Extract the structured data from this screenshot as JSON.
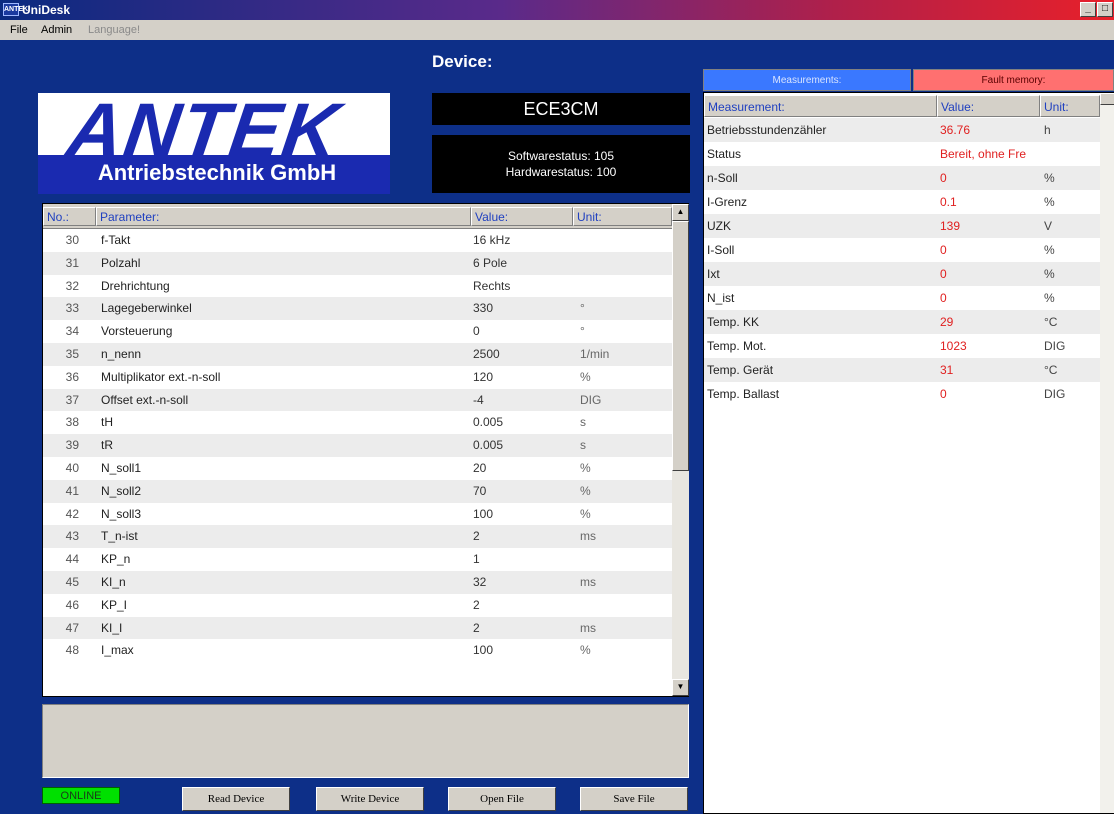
{
  "window": {
    "title": "UniDesk",
    "icon_text": "ANTEK",
    "controls": [
      "_",
      "□",
      "x"
    ]
  },
  "menu": [
    {
      "label": "File",
      "enabled": true
    },
    {
      "label": "Admin",
      "enabled": true
    },
    {
      "label": "Language!",
      "enabled": false
    }
  ],
  "logo": {
    "word": "ANTEK",
    "subtitle": "Antriebstechnik GmbH"
  },
  "device": {
    "label": "Device:",
    "name": "ECE3CM",
    "software_status": "Softwarestatus: 105",
    "hardware_status": "Hardwarestatus: 100"
  },
  "parameters": {
    "headers": {
      "no": "No.:",
      "parameter": "Parameter:",
      "value": "Value:",
      "unit": "Unit:"
    },
    "rows": [
      {
        "no": "30",
        "name": "f-Takt",
        "value": "16 kHz",
        "unit": ""
      },
      {
        "no": "31",
        "name": "Polzahl",
        "value": "6 Pole",
        "unit": ""
      },
      {
        "no": "32",
        "name": "Drehrichtung",
        "value": "Rechts",
        "unit": ""
      },
      {
        "no": "33",
        "name": "Lagegeberwinkel",
        "value": "330",
        "unit": "°"
      },
      {
        "no": "34",
        "name": "Vorsteuerung",
        "value": "0",
        "unit": "°"
      },
      {
        "no": "35",
        "name": "n_nenn",
        "value": "2500",
        "unit": "1/min"
      },
      {
        "no": "36",
        "name": "Multiplikator ext.-n-soll",
        "value": "120",
        "unit": "%"
      },
      {
        "no": "37",
        "name": "Offset ext.-n-soll",
        "value": "-4",
        "unit": "DIG"
      },
      {
        "no": "38",
        "name": "tH",
        "value": "0.005",
        "unit": "s"
      },
      {
        "no": "39",
        "name": "tR",
        "value": "0.005",
        "unit": "s"
      },
      {
        "no": "40",
        "name": "N_soll1",
        "value": "20",
        "unit": "%"
      },
      {
        "no": "41",
        "name": "N_soll2",
        "value": "70",
        "unit": "%"
      },
      {
        "no": "42",
        "name": "N_soll3",
        "value": "100",
        "unit": "%"
      },
      {
        "no": "43",
        "name": "T_n-ist",
        "value": "2",
        "unit": "ms"
      },
      {
        "no": "44",
        "name": "KP_n",
        "value": "1",
        "unit": ""
      },
      {
        "no": "45",
        "name": "KI_n",
        "value": "32",
        "unit": "ms"
      },
      {
        "no": "46",
        "name": "KP_I",
        "value": "2",
        "unit": ""
      },
      {
        "no": "47",
        "name": "KI_I",
        "value": "2",
        "unit": "ms"
      },
      {
        "no": "48",
        "name": "I_max",
        "value": "100",
        "unit": "%"
      }
    ]
  },
  "measurements": {
    "tabs": {
      "measurements": "Measurements:",
      "fault_memory": "Fault memory:"
    },
    "headers": {
      "measurement": "Measurement:",
      "value": "Value:",
      "unit": "Unit:"
    },
    "rows": [
      {
        "name": "Betriebsstundenzähler",
        "value": "36.76",
        "unit": "h"
      },
      {
        "name": "Status",
        "value": "Bereit, ohne Fre",
        "unit": ""
      },
      {
        "name": "n-Soll",
        "value": "0",
        "unit": "%"
      },
      {
        "name": "I-Grenz",
        "value": "0.1",
        "unit": "%"
      },
      {
        "name": "UZK",
        "value": "139",
        "unit": "V"
      },
      {
        "name": "I-Soll",
        "value": "0",
        "unit": "%"
      },
      {
        "name": "Ixt",
        "value": "0",
        "unit": "%"
      },
      {
        "name": "N_ist",
        "value": "0",
        "unit": "%"
      },
      {
        "name": "Temp. KK",
        "value": "29",
        "unit": "°C"
      },
      {
        "name": "Temp. Mot.",
        "value": "1023",
        "unit": "DIG"
      },
      {
        "name": "Temp. Gerät",
        "value": "31",
        "unit": "°C"
      },
      {
        "name": "Temp. Ballast",
        "value": "0",
        "unit": "DIG"
      }
    ]
  },
  "status": {
    "online": "ONLINE"
  },
  "buttons": {
    "read_device": "Read Device",
    "write_device": "Write Device",
    "open_file": "Open File",
    "save_file": "Save File"
  },
  "colors": {
    "background": "#0d2f88",
    "logo_blue": "#1a2ab0",
    "tab_measurements": "#3a78ff",
    "tab_fault": "#ff7070",
    "online": "#00e000",
    "measurement_value": "#e02020"
  }
}
